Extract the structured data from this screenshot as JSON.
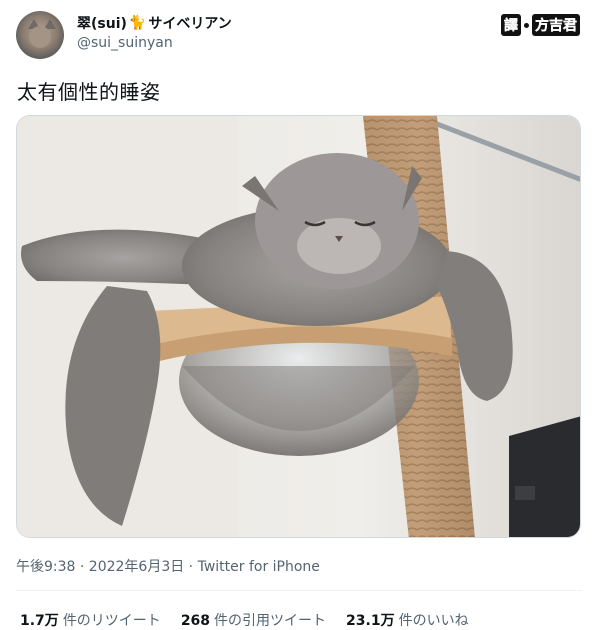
{
  "tweet": {
    "display_name_prefix": "翠(sui)",
    "display_name_suffix": "サイベリアン",
    "username": "@sui_suinyan",
    "text": "太有個性的睡姿",
    "timestamp": "午後9:38 · 2022年6月3日 · Twitter for iPhone"
  },
  "watermark": {
    "part1": "譯",
    "part2": "方吉君"
  },
  "stats": [
    {
      "value": "1.7万",
      "label": "件のリツイート"
    },
    {
      "value": "268",
      "label": "件の引用ツイート"
    },
    {
      "value": "23.1万",
      "label": "件のいいね"
    }
  ],
  "icons": {
    "avatar": "cat-avatar",
    "name_emoji": "black-cat-emoji"
  }
}
